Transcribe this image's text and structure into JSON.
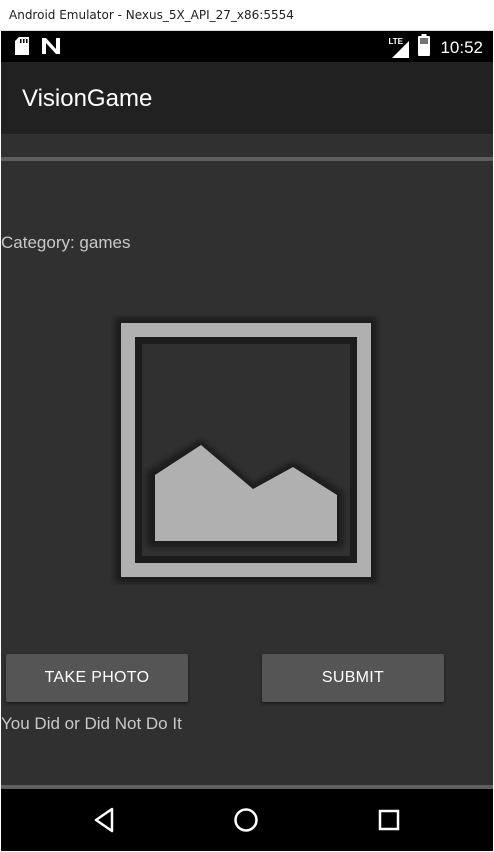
{
  "window": {
    "title": "Android Emulator - Nexus_5X_API_27_x86:5554"
  },
  "status_bar": {
    "time": "10:52",
    "network": "LTE",
    "icons": [
      "sd-card-icon",
      "notification-n-icon",
      "lte-signal-icon",
      "battery-icon"
    ]
  },
  "app_bar": {
    "title": "VisionGame"
  },
  "main": {
    "category_text": "Category: games",
    "image": {
      "icon": "image-placeholder-icon"
    },
    "take_photo_label": "TAKE PHOTO",
    "submit_label": "SUBMIT",
    "result_text": "You Did or Did Not Do It"
  },
  "nav_bar": {
    "icons": [
      "back-icon",
      "home-icon",
      "recents-icon"
    ]
  },
  "colors": {
    "background": "#303030",
    "app_bar": "#212121",
    "button": "#555555",
    "divider": "#5f5f5f",
    "text_secondary": "#c9c9c9"
  }
}
